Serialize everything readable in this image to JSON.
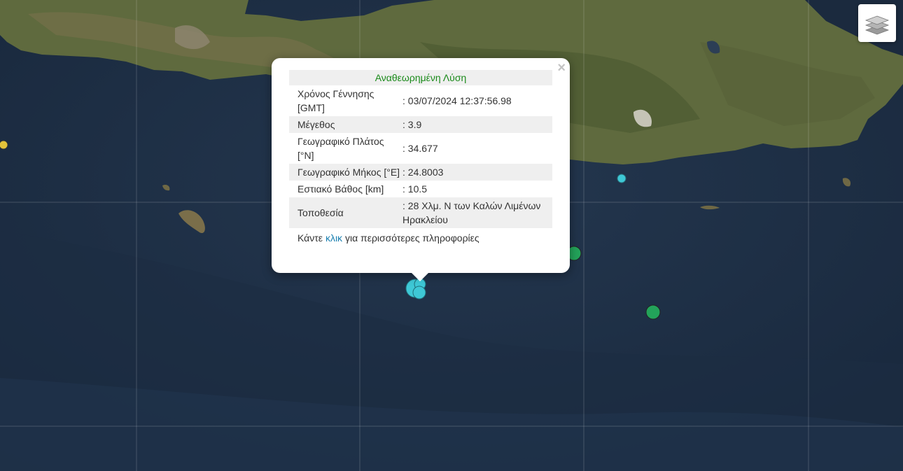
{
  "map": {
    "layer_control_icon": "layers-icon",
    "colors": {
      "marker_cyan": "#3ec8d6",
      "marker_green": "#23a35a",
      "marker_yellow": "#e3c23a"
    }
  },
  "popup": {
    "heading": "Αναθεωρημένη Λύση",
    "close_label": "×",
    "rows": [
      {
        "label": "Χρόνος Γέννησης [GMT]",
        "value": ": 03/07/2024 12:37:56.98"
      },
      {
        "label": "Μέγεθος",
        "value": ": 3.9"
      },
      {
        "label": "Γεωγραφικό Πλάτος [°N]",
        "value": ": 34.677"
      },
      {
        "label": "Γεωγραφικό Μήκος [°E]",
        "value": ": 24.8003"
      },
      {
        "label": "Εστιακό Βάθος [km]",
        "value": ": 10.5"
      },
      {
        "label": "Τοποθεσία",
        "value": ": 28 Χλμ. Ν των Καλών Λιμένων Ηρακλείου"
      }
    ],
    "footer_prefix": "Κάντε",
    "footer_link": "κλικ",
    "footer_suffix": "για περισσότερες πληροφορίες"
  }
}
